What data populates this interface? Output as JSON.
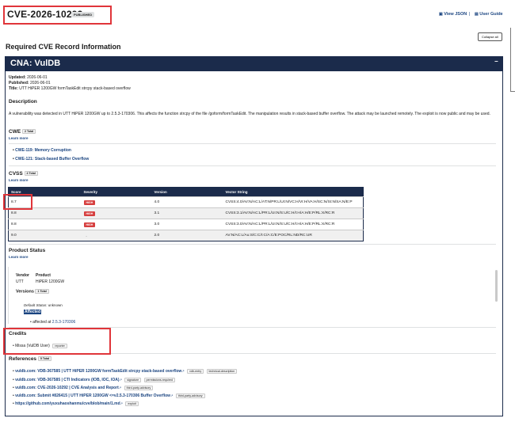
{
  "header": {
    "cve_id": "CVE-2026-10292",
    "state_badge": "PUBLISHED",
    "view_json": "View JSON",
    "separator": "|",
    "user_guide": "User Guide",
    "section_title": "Required CVE Record Information",
    "collapse_all": "Collapse all"
  },
  "cna": {
    "title": "CNA: VulDB",
    "collapse_glyph": "−",
    "updated_label": "Updated:",
    "updated": "2026-06-01",
    "published_label": "Published:",
    "published": "2026-06-01",
    "title_label": "Title:",
    "record_title": "UTT HiPER 1200GW formTaskEdit strcpy stack-based overflow"
  },
  "description": {
    "heading": "Description",
    "text": "A vulnerability was detected in UTT HiPER 1200GW up to 2.5.3-170306. This affects the function strcpy of the file /goform/formTaskEdit. The manipulation results in stack-based buffer overflow. The attack may be launched remotely. The exploit is now public and may be used."
  },
  "cwe": {
    "heading": "CWE",
    "count": "2 Total",
    "learn_more": "Learn more",
    "items": [
      "CWE-119: Memory Corruption",
      "CWE-121: Stack-based Buffer Overflow"
    ]
  },
  "cvss": {
    "heading": "CVSS",
    "count": "4 Total",
    "learn_more": "Learn more",
    "columns": [
      "Score",
      "Severity",
      "Version",
      "Vector String"
    ],
    "rows": [
      {
        "score": "8.7",
        "severity": "HIGH",
        "version": "4.0",
        "vector": "CVSS:4.0/AV:N/AC:L/AT:N/PR:L/UI:N/VC:H/VI:H/VA:H/SC:N/SI:N/SA:N/E:P"
      },
      {
        "score": "8.8",
        "severity": "HIGH",
        "version": "3.1",
        "vector": "CVSS:3.1/AV:N/AC:L/PR:L/UI:N/S:U/C:H/I:H/A:H/E:P/RL:X/RC:R"
      },
      {
        "score": "8.8",
        "severity": "HIGH",
        "version": "3.0",
        "vector": "CVSS:3.0/AV:N/AC:L/PR:L/UI:N/S:U/C:H/I:H/A:H/E:P/RL:X/RC:R"
      },
      {
        "score": "9.0",
        "severity": "-",
        "version": "2.0",
        "vector": "AV:N/AC:L/Au:S/C:C/I:C/A:C/E:POC/RL:ND/RC:UR"
      }
    ]
  },
  "product_status": {
    "heading": "Product Status",
    "learn_more": "Learn more",
    "vendor_label": "Vendor",
    "product_label": "Product",
    "vendor": "UTT",
    "product": "HiPER 1200GW",
    "versions_label": "Versions",
    "versions_count": "1 Total",
    "default_status_label": "Default Status:",
    "default_status": "unknown",
    "affected_label": "Affected",
    "affected_at_prefix": "affected at",
    "affected_version": "2.5.3-170306"
  },
  "credits": {
    "heading": "Credits",
    "items": [
      {
        "name": "Missa (VulDB User)",
        "role": "reporter"
      }
    ]
  },
  "references": {
    "heading": "References",
    "count": "5 Total",
    "items": [
      {
        "text": "vuldb.com: VDB-367585 | UTT HiPER 1200GW formTaskEdit strcpy stack-based overflow",
        "tags": [
          "vdb-entry",
          "technical-description"
        ]
      },
      {
        "text": "vuldb.com: VDB-367585 | CTI Indicators (IOB, IOC, IOA)",
        "tags": [
          "signature",
          "permissions-required"
        ]
      },
      {
        "text": "vuldb.com: CVE-2026-10292 | CVE Analysis and Report",
        "tags": [
          "third-party-advisory"
        ]
      },
      {
        "text": "vuldb.com: Submit #826415 | UTT HiPER 1200GW <=v2.5.3-170306 Buffer Overflow",
        "tags": [
          "third-party-advisory"
        ]
      },
      {
        "text": "https://github.com/yuxuhaoshanmu/cve/blob/main/1.md",
        "tags": [
          "exploit"
        ]
      }
    ]
  },
  "colors": {
    "navy": "#1b2b4b",
    "link": "#1a4480",
    "annotation_red": "#e0353a",
    "severity_high": "#d63e3e"
  }
}
